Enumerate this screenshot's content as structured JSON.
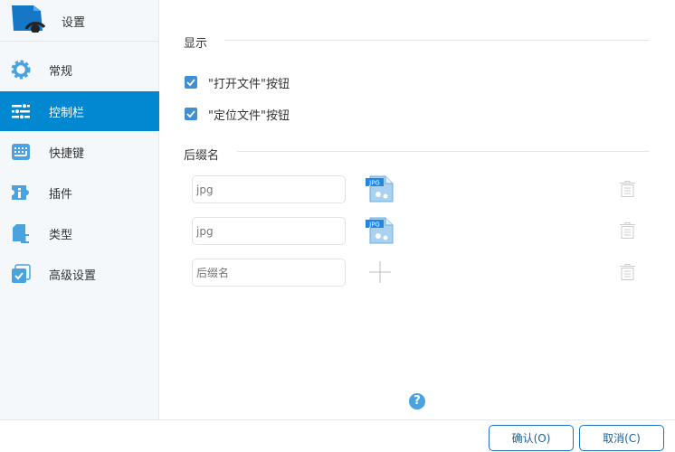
{
  "sidebar": {
    "title": "设置",
    "items": [
      {
        "label": "常规",
        "icon": "gear-icon"
      },
      {
        "label": "控制栏",
        "icon": "sliders-icon",
        "active": true
      },
      {
        "label": "快捷键",
        "icon": "keyboard-icon"
      },
      {
        "label": "插件",
        "icon": "puzzle-icon"
      },
      {
        "label": "类型",
        "icon": "file-type-icon"
      },
      {
        "label": "高级设置",
        "icon": "advanced-check-icon"
      }
    ]
  },
  "main": {
    "display_section": "显示",
    "checkboxes": [
      {
        "label": "\"打开文件\"按钮",
        "checked": true
      },
      {
        "label": "\"定位文件\"按钮",
        "checked": true
      }
    ],
    "suffix_section": "后缀名",
    "suffixes": [
      {
        "value": "jpg",
        "icon_label": "JPG"
      },
      {
        "value": "jpg",
        "icon_label": "JPG"
      }
    ],
    "new_suffix_placeholder": "后缀名",
    "help": "?"
  },
  "footer": {
    "ok": "确认(O)",
    "cancel": "取消(C)"
  },
  "colors": {
    "accent": "#0288d1",
    "icon": "#4aa3df"
  }
}
